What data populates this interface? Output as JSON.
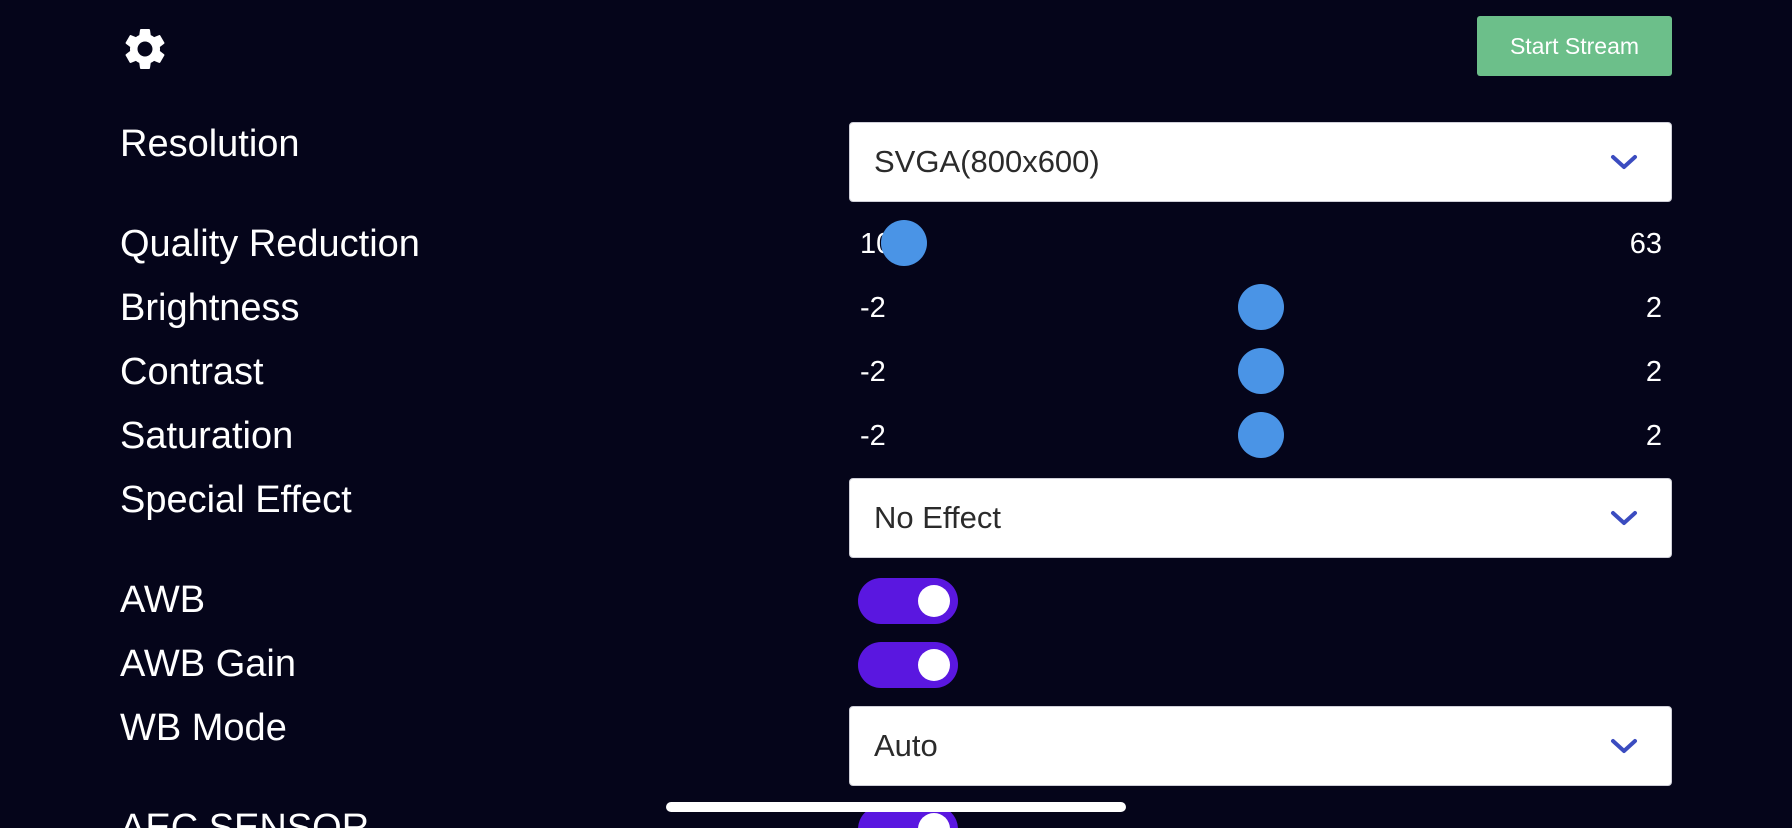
{
  "header": {
    "settings_icon": "gear-icon",
    "start_stream_label": "Start Stream"
  },
  "settings": {
    "resolution": {
      "label": "Resolution",
      "value": "SVGA(800x600)"
    },
    "quality": {
      "label": "Quality Reduction",
      "min": "10",
      "max": "63",
      "value": 10
    },
    "brightness": {
      "label": "Brightness",
      "min": "-2",
      "max": "2",
      "value": 0
    },
    "contrast": {
      "label": "Contrast",
      "min": "-2",
      "max": "2",
      "value": 0
    },
    "saturation": {
      "label": "Saturation",
      "min": "-2",
      "max": "2",
      "value": 0
    },
    "special_effect": {
      "label": "Special Effect",
      "value": "No Effect"
    },
    "awb": {
      "label": "AWB",
      "on": true
    },
    "awb_gain": {
      "label": "AWB Gain",
      "on": true
    },
    "wb_mode": {
      "label": "WB Mode",
      "value": "Auto"
    },
    "aec_sensor": {
      "label": "AEC SENSOR",
      "on": true
    }
  },
  "colors": {
    "background": "#05051a",
    "accent_button": "#6cbf8a",
    "slider_thumb": "#4a94e6",
    "toggle_on": "#5a17e0",
    "chevron": "#3b4cc0"
  }
}
